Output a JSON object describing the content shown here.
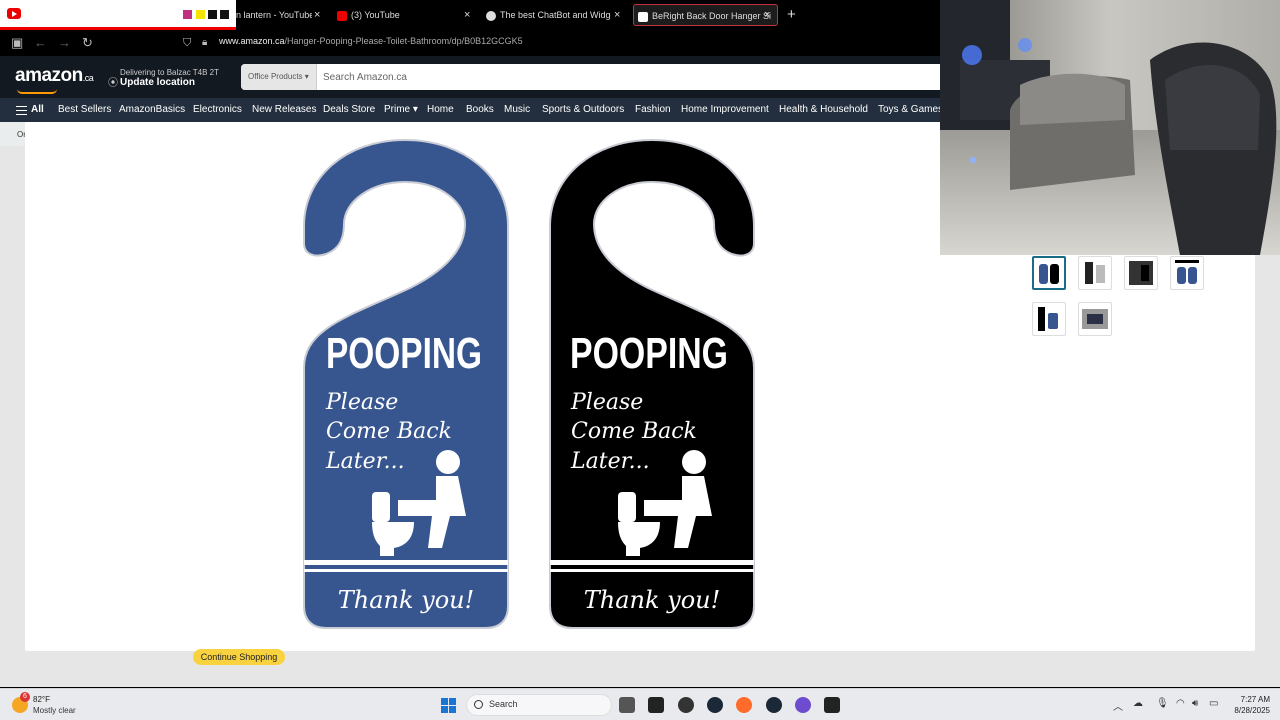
{
  "browser": {
    "tabs": [
      {
        "label": "n lantern - YouTube M",
        "favicon_color": "#e00000"
      },
      {
        "label": "(3) YouTube",
        "favicon_color": "#e00000"
      },
      {
        "label": "The best ChatBot and Widgets",
        "favicon_color": "#dddddd"
      },
      {
        "label": "BeRight Back Door Hanger Si",
        "favicon_color": "#ffffff",
        "active": true
      }
    ],
    "close_glyph": "×",
    "new_tab_glyph": "+",
    "url_domain": "www.amazon.ca",
    "url_path": "/Hanger-Pooping-Please-Toilet-Bathroom/dp/B0B12GCGK5"
  },
  "amazon": {
    "logo": "amazon",
    "logo_suffix": ".ca",
    "deliver_line1": "Delivering to Balzac T4B 2T",
    "deliver_line2": "Update location",
    "search_dept": "Office Products ▾",
    "search_placeholder": "Search Amazon.ca",
    "nav_items": [
      "All",
      "Best Sellers",
      "AmazonBasics",
      "Electronics",
      "New Releases",
      "Deals Store",
      "Prime ▾",
      "Home",
      "Books",
      "Music",
      "Sports & Outdoors",
      "Fashion",
      "Home Improvement",
      "Health & Household",
      "Toys & Games"
    ],
    "sub_text": "Or",
    "continue_button": "Continue Shopping"
  },
  "product_image": {
    "blue_hanger": {
      "title_big": "POOPING",
      "script_line1": "Please",
      "script_line2": "Come Back",
      "script_line3": "Later...",
      "footer": "Thank you!",
      "color": "#37558f"
    },
    "black_hanger": {
      "title_big": "POOPING",
      "script_line1": "Please",
      "script_line2": "Come Back",
      "script_line3": "Later...",
      "footer": "Thank you!",
      "color": "#000000"
    }
  },
  "thumbnails_count": 6,
  "taskbar": {
    "weather_temp": "82°F",
    "weather_desc": "Mostly clear",
    "weather_badge": "6",
    "search_label": "Search",
    "time": "7:27 AM",
    "date": "8/28/2025"
  }
}
